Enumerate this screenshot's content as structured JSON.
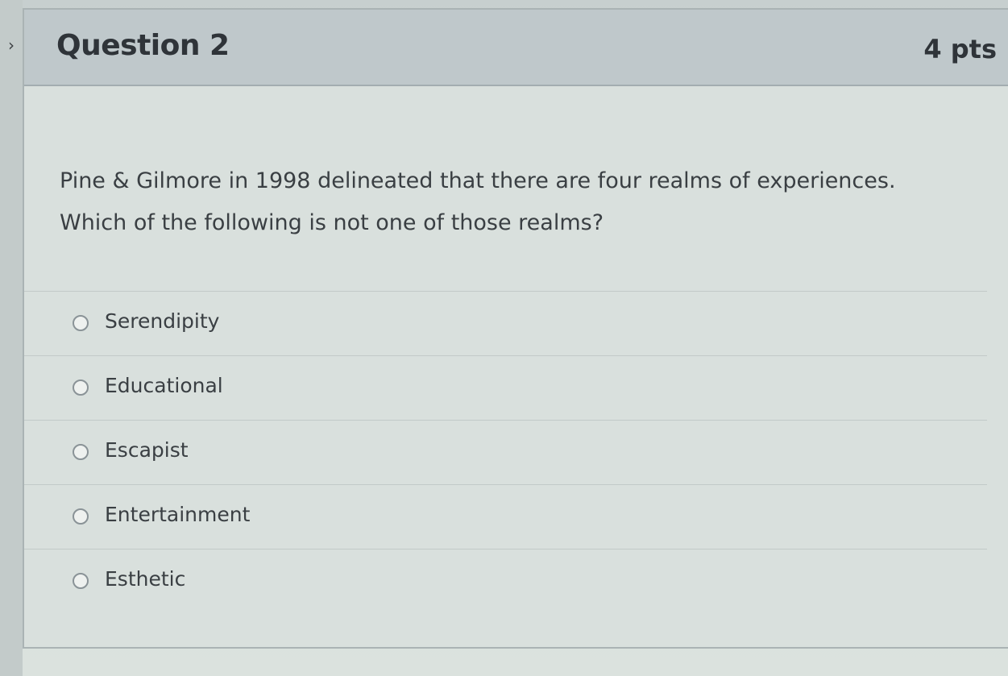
{
  "question": {
    "title": "Question 2",
    "points": "4 pts",
    "text": "Pine & Gilmore in 1998 delineated that there are four realms of experiences. Which of the following is not one of those realms?"
  },
  "answers": [
    {
      "label": "Serendipity"
    },
    {
      "label": "Educational"
    },
    {
      "label": "Escapist"
    },
    {
      "label": "Entertainment"
    },
    {
      "label": "Esthetic"
    }
  ],
  "icons": {
    "collapse": "chevron-right-icon",
    "radio": "radio-unselected-icon"
  }
}
